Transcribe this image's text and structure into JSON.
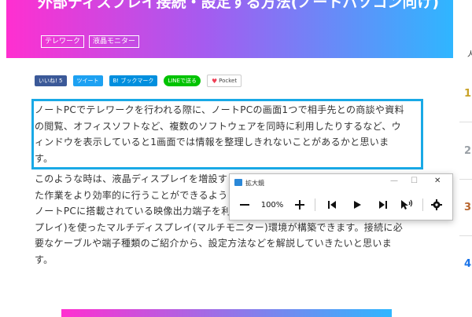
{
  "hero": {
    "title": "外部ディスプレイ接続・設定する方法(ノートパソコン向け)",
    "tags": [
      "テレワーク",
      "液晶モニター"
    ]
  },
  "share": {
    "like": "いいね! 5",
    "tweet": "ツイート",
    "hatena": "B! ブックマーク",
    "line": "LINEで送る",
    "pocket": "Pocket"
  },
  "article": {
    "para1_lines": [
      "ノートPCでテレワークを行われる際に、ノートPCの画面1つで相手先との商談や資料",
      "の閲覧、オフィスソフトなど、複数のソフトウェアを同時に利用したりするなど、ウ",
      "ィンドウを表示していると1画面では情報を整理しきれないことがあるかと思いま",
      "す。"
    ],
    "para2_lines": [
      "このような時は、液晶ディスプレイを増設す",
      "た作業をより効率的に行うことができるよう",
      "ノートPCに搭載されている映像出力端子を利用して、外部ディスプレイ(液晶ディス",
      "プレイ)を使ったマルチディスプレイ(マルチモニター)環境が構築できます。接続に必",
      "要なケーブルや端子種類のご紹介から、設定方法などを解説していきたいと思いま",
      "す。"
    ]
  },
  "sidebar": {
    "label": "人",
    "numbers": [
      "1",
      "2",
      "3",
      "4"
    ],
    "colors": [
      "#c9a227",
      "#9aa0a6",
      "#b8662f",
      "#1a73e8"
    ]
  },
  "magnifier": {
    "title": "拡大鏡",
    "zoom_level": "100%",
    "minimize": "—",
    "maximize": "☐",
    "close": "✕"
  }
}
